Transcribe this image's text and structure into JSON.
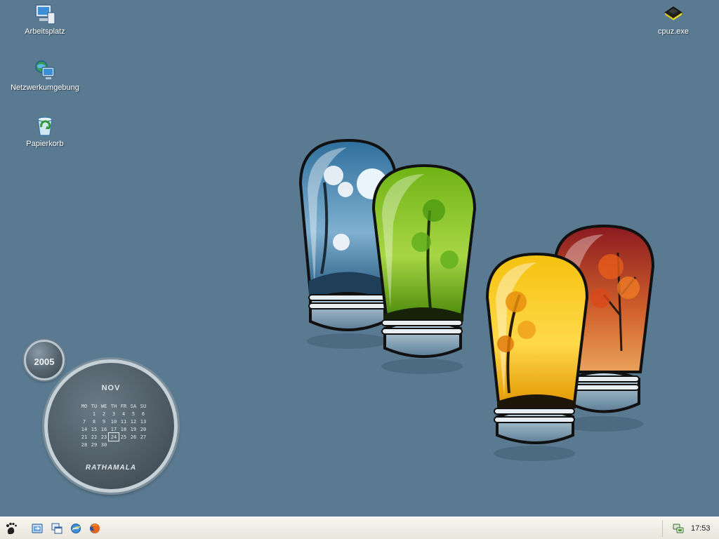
{
  "desktop": {
    "background_color": "#5a7a91",
    "icons": [
      {
        "label": "Arbeitsplatz",
        "icon": "my-computer-icon"
      },
      {
        "label": "Netzwerkumgebung",
        "icon": "network-places-icon"
      },
      {
        "label": "Papierkorb",
        "icon": "recycle-bin-icon"
      },
      {
        "label": "cpuz.exe",
        "icon": "cpu-chip-icon"
      }
    ]
  },
  "calendar_widget": {
    "year": "2005",
    "month": "NOV",
    "weekdays": [
      "MO",
      "TU",
      "WE",
      "TH",
      "FR",
      "SA",
      "SU"
    ],
    "weeks": [
      [
        "",
        "1",
        "2",
        "3",
        "4",
        "5",
        "6"
      ],
      [
        "7",
        "8",
        "9",
        "10",
        "11",
        "12",
        "13"
      ],
      [
        "14",
        "15",
        "16",
        "17",
        "18",
        "19",
        "20"
      ],
      [
        "21",
        "22",
        "23",
        "24",
        "25",
        "26",
        "27"
      ],
      [
        "28",
        "29",
        "30",
        "",
        "",
        "",
        ""
      ]
    ],
    "today": "24",
    "brand": "RATHAMALA"
  },
  "taskbar": {
    "start_icon": "gnome-foot-icon",
    "quick_launch": [
      "show-desktop-icon",
      "window-switch-icon",
      "internet-explorer-icon",
      "firefox-icon"
    ],
    "tray_icon": "network-tray-icon",
    "time": "17:53"
  }
}
